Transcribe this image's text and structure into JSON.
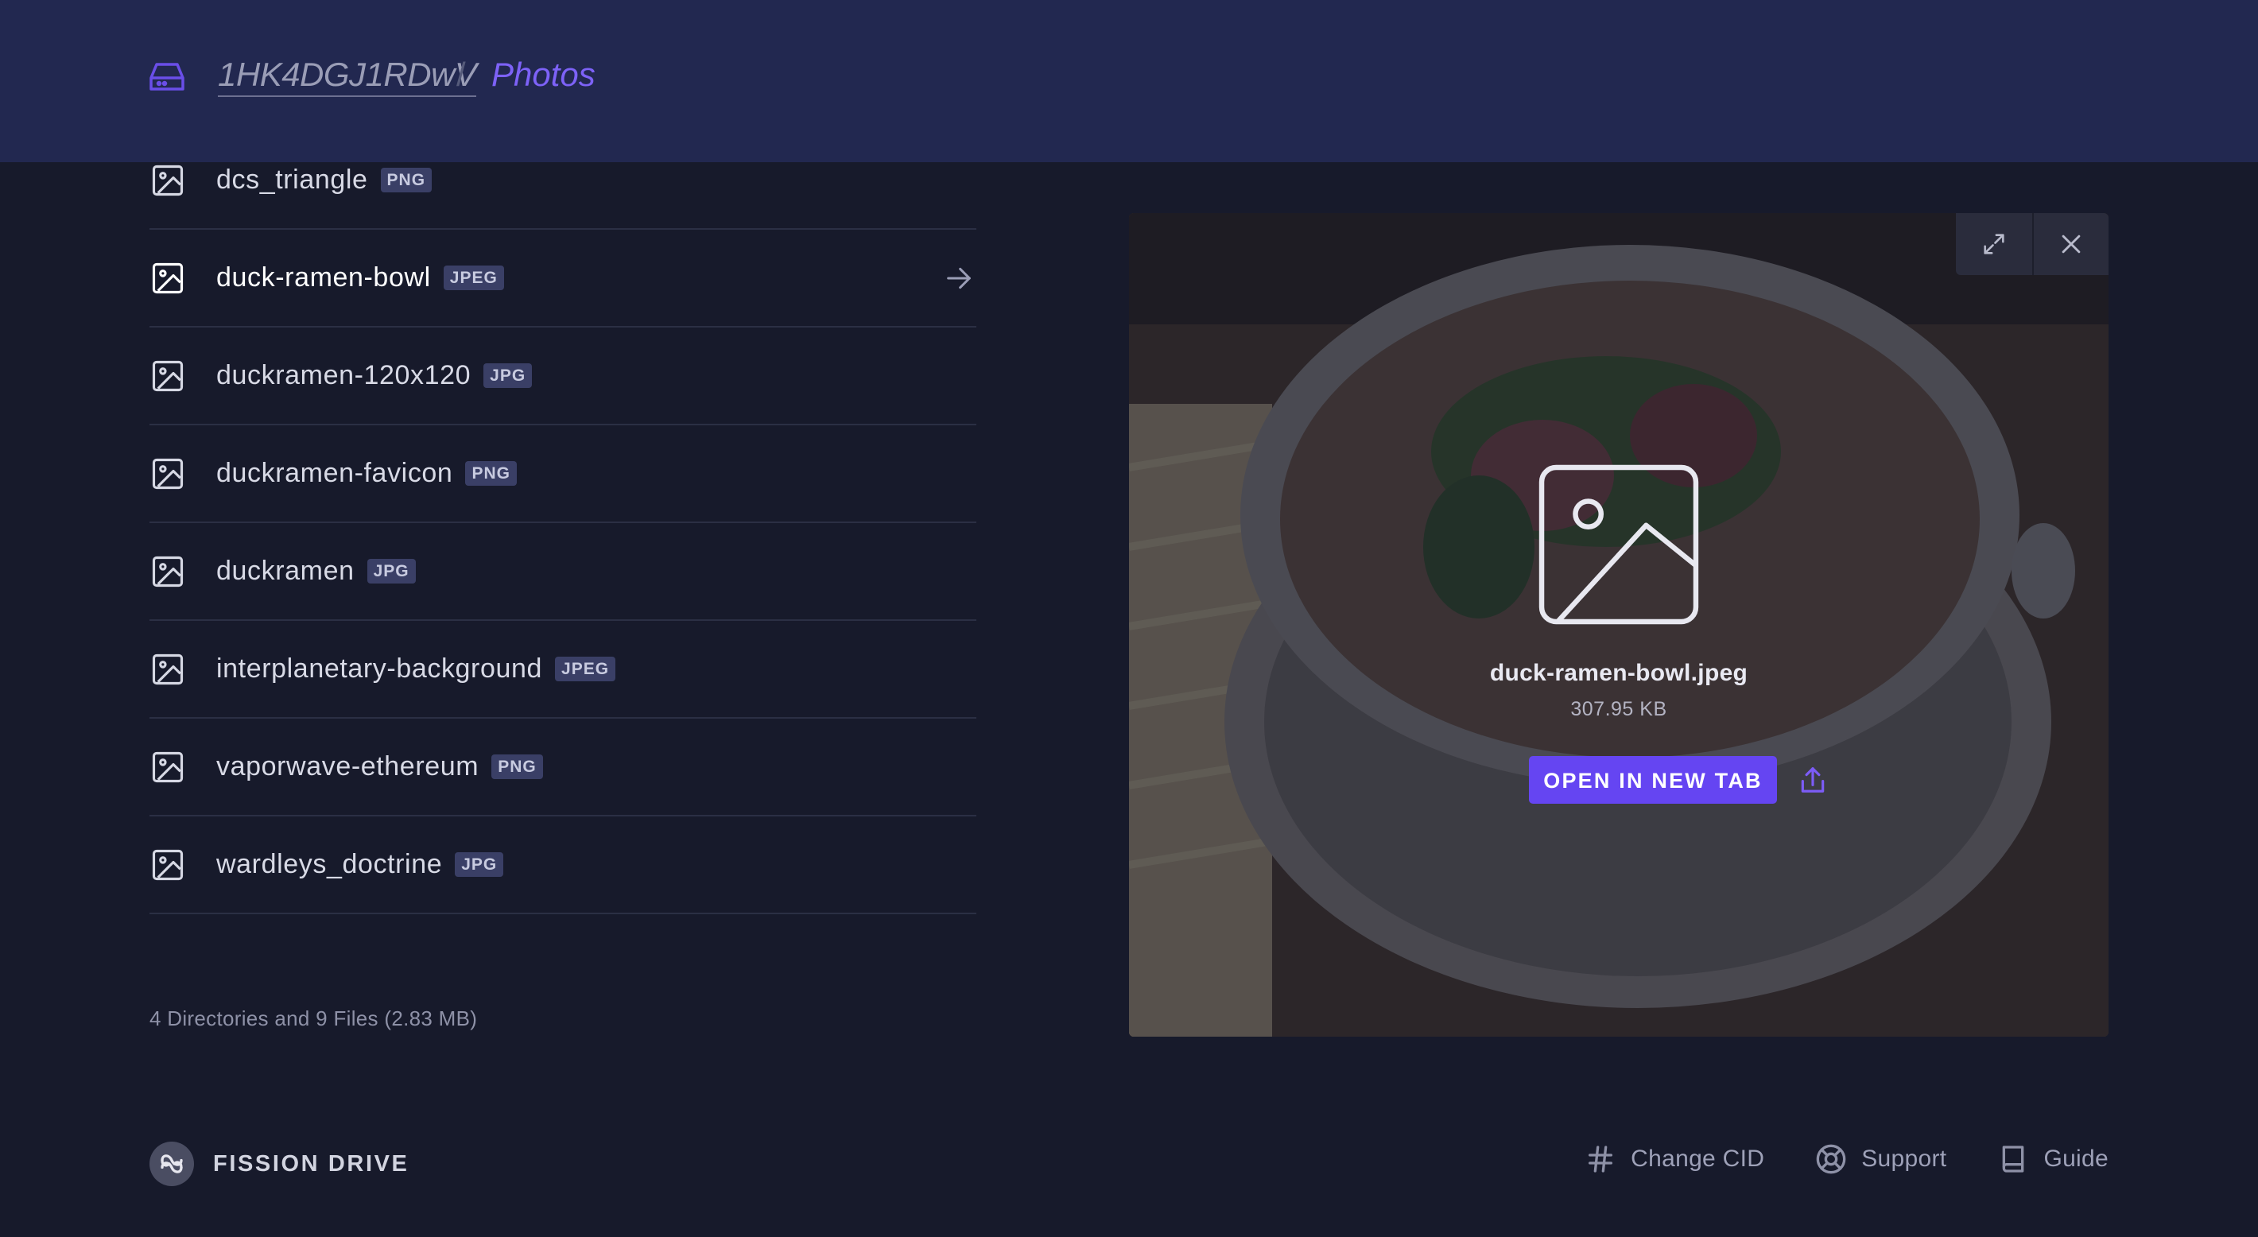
{
  "header": {
    "root_label": "1HK4DGJ1RDwV",
    "separator": "/",
    "current_label": "Photos"
  },
  "files": [
    {
      "name": "dcs_triangle",
      "ext": "PNG"
    },
    {
      "name": "duck-ramen-bowl",
      "ext": "JPEG",
      "selected": true
    },
    {
      "name": "duckramen-120x120",
      "ext": "JPG"
    },
    {
      "name": "duckramen-favicon",
      "ext": "PNG"
    },
    {
      "name": "duckramen",
      "ext": "JPG"
    },
    {
      "name": "interplanetary-background",
      "ext": "JPEG"
    },
    {
      "name": "vaporwave-ethereum",
      "ext": "PNG"
    },
    {
      "name": "wardleys_doctrine",
      "ext": "JPG"
    }
  ],
  "summary": "4 Directories and 9 Files (2.83 MB)",
  "preview": {
    "filename": "duck-ramen-bowl.jpeg",
    "size": "307.95 KB",
    "open_button": "OPEN IN NEW TAB",
    "icons": [
      "expand-icon",
      "close-icon",
      "image-icon",
      "share-icon"
    ]
  },
  "footer": {
    "brand": "FISSION DRIVE",
    "links": [
      {
        "label": "Change CID",
        "icon": "hash-icon"
      },
      {
        "label": "Support",
        "icon": "lifebuoy-icon"
      },
      {
        "label": "Guide",
        "icon": "book-icon"
      }
    ]
  },
  "colors": {
    "background": "#171a2b",
    "header": "#222850",
    "accent": "#6545f2",
    "breadcrumb_current": "#7d62f7",
    "badge": "#3a3f66"
  }
}
